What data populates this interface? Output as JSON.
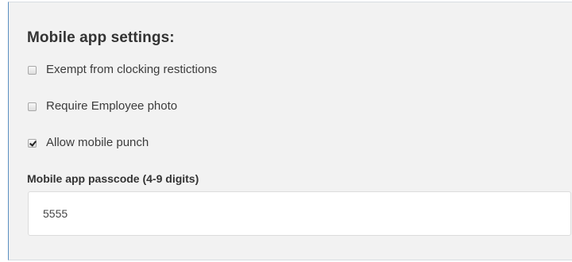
{
  "section": {
    "title": "Mobile app settings:"
  },
  "options": [
    {
      "label": "Exempt from clocking restictions",
      "checked": false
    },
    {
      "label": "Require Employee photo",
      "checked": false
    },
    {
      "label": "Allow mobile punch",
      "checked": true
    }
  ],
  "passcode": {
    "label": "Mobile app passcode (4-9 digits)",
    "value": "5555"
  },
  "colors": {
    "panel_background": "#f2f2f2",
    "panel_accent_border": "#5b8fc2",
    "input_background": "#ffffff"
  }
}
